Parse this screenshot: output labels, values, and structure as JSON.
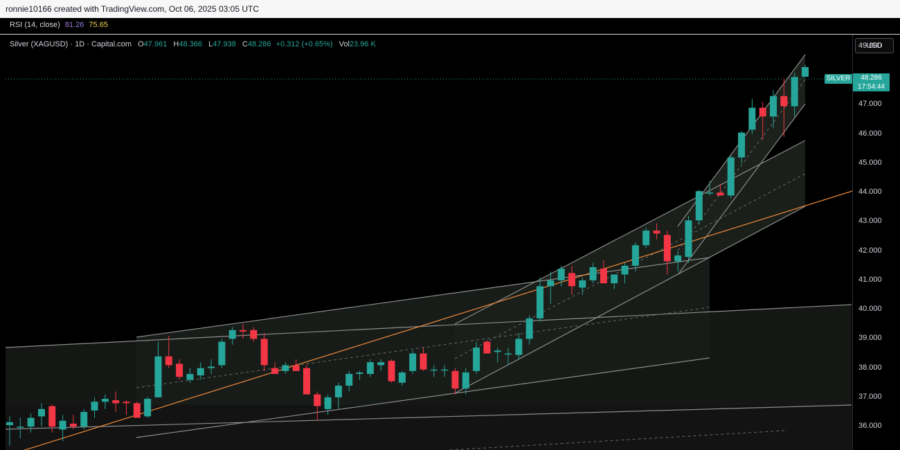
{
  "header": {
    "attribution": "ronnie10166 created with TradingView.com, Oct 06, 2025 03:05 UTC"
  },
  "rsi": {
    "label": "RSI (14, close)",
    "value1": "81.26",
    "value2": "75.65"
  },
  "legend": {
    "symbol": "Silver (XAGUSD) · 1D · Capital.com",
    "o_key": "O",
    "o": "47.961",
    "h_key": "H",
    "h": "48.366",
    "l_key": "L",
    "l": "47.938",
    "c_key": "C",
    "c": "48.286",
    "change": "+0.312 (+0.65%)",
    "vol_key": "Vol",
    "vol": "23.96 K"
  },
  "price_axis": {
    "currency_button": "USD",
    "ticks": [
      "49.000",
      "47.000",
      "46.000",
      "45.000",
      "44.000",
      "43.000",
      "42.000",
      "41.000",
      "40.000",
      "39.000",
      "38.000",
      "37.000",
      "36.000"
    ]
  },
  "last_price": {
    "symbol_tag": "SILVER",
    "price": "48.286",
    "countdown": "17:54:44"
  },
  "colors": {
    "up": "#26a69a",
    "down": "#f23645",
    "channel": "#9a9a9a",
    "trend": "#f08c3c"
  },
  "chart_data": {
    "type": "candlestick",
    "ylim": [
      35.2,
      49.4
    ],
    "candles": [
      {
        "o": 36.05,
        "h": 36.35,
        "l": 35.35,
        "c": 36.15
      },
      {
        "o": 36.0,
        "h": 36.3,
        "l": 35.6,
        "c": 36.0
      },
      {
        "o": 36.0,
        "h": 36.45,
        "l": 35.8,
        "c": 36.3
      },
      {
        "o": 36.35,
        "h": 36.8,
        "l": 36.0,
        "c": 36.6
      },
      {
        "o": 36.7,
        "h": 36.75,
        "l": 35.8,
        "c": 36.0
      },
      {
        "o": 35.9,
        "h": 36.4,
        "l": 35.5,
        "c": 36.2
      },
      {
        "o": 36.1,
        "h": 36.4,
        "l": 35.9,
        "c": 36.0
      },
      {
        "o": 36.0,
        "h": 36.6,
        "l": 35.9,
        "c": 36.5
      },
      {
        "o": 36.55,
        "h": 37.0,
        "l": 36.3,
        "c": 36.85
      },
      {
        "o": 36.85,
        "h": 37.1,
        "l": 36.6,
        "c": 36.95
      },
      {
        "o": 36.9,
        "h": 37.2,
        "l": 36.5,
        "c": 36.8
      },
      {
        "o": 36.85,
        "h": 36.9,
        "l": 36.4,
        "c": 36.8
      },
      {
        "o": 36.8,
        "h": 36.85,
        "l": 36.3,
        "c": 36.3
      },
      {
        "o": 36.35,
        "h": 37.0,
        "l": 36.3,
        "c": 36.95
      },
      {
        "o": 37.0,
        "h": 38.9,
        "l": 37.0,
        "c": 38.4
      },
      {
        "o": 38.4,
        "h": 39.1,
        "l": 38.0,
        "c": 38.1
      },
      {
        "o": 38.15,
        "h": 38.3,
        "l": 37.6,
        "c": 37.7
      },
      {
        "o": 37.6,
        "h": 38.0,
        "l": 37.5,
        "c": 37.8
      },
      {
        "o": 37.75,
        "h": 38.2,
        "l": 37.6,
        "c": 38.0
      },
      {
        "o": 38.0,
        "h": 38.3,
        "l": 37.8,
        "c": 38.05
      },
      {
        "o": 38.1,
        "h": 39.0,
        "l": 38.0,
        "c": 38.9
      },
      {
        "o": 39.0,
        "h": 39.4,
        "l": 38.8,
        "c": 39.3
      },
      {
        "o": 39.3,
        "h": 39.5,
        "l": 39.0,
        "c": 39.25
      },
      {
        "o": 39.3,
        "h": 39.4,
        "l": 38.9,
        "c": 39.0
      },
      {
        "o": 39.0,
        "h": 39.2,
        "l": 37.9,
        "c": 38.1
      },
      {
        "o": 38.0,
        "h": 38.2,
        "l": 37.8,
        "c": 37.8
      },
      {
        "o": 37.9,
        "h": 38.2,
        "l": 37.8,
        "c": 38.1
      },
      {
        "o": 38.1,
        "h": 38.3,
        "l": 37.9,
        "c": 37.9
      },
      {
        "o": 38.0,
        "h": 38.1,
        "l": 37.3,
        "c": 37.1
      },
      {
        "o": 37.1,
        "h": 37.2,
        "l": 36.2,
        "c": 36.7
      },
      {
        "o": 36.6,
        "h": 37.1,
        "l": 36.4,
        "c": 37.0
      },
      {
        "o": 37.0,
        "h": 37.5,
        "l": 36.6,
        "c": 37.4
      },
      {
        "o": 37.4,
        "h": 37.9,
        "l": 37.2,
        "c": 37.8
      },
      {
        "o": 37.8,
        "h": 37.9,
        "l": 37.6,
        "c": 37.85
      },
      {
        "o": 37.8,
        "h": 38.3,
        "l": 37.7,
        "c": 38.2
      },
      {
        "o": 38.1,
        "h": 38.3,
        "l": 37.9,
        "c": 38.2
      },
      {
        "o": 38.25,
        "h": 38.3,
        "l": 37.5,
        "c": 37.55
      },
      {
        "o": 37.5,
        "h": 37.9,
        "l": 37.4,
        "c": 37.85
      },
      {
        "o": 37.9,
        "h": 38.6,
        "l": 37.8,
        "c": 38.5
      },
      {
        "o": 38.5,
        "h": 38.7,
        "l": 37.9,
        "c": 37.95
      },
      {
        "o": 37.95,
        "h": 38.1,
        "l": 37.7,
        "c": 37.95
      },
      {
        "o": 37.95,
        "h": 38.1,
        "l": 37.7,
        "c": 37.95
      },
      {
        "o": 37.9,
        "h": 38.0,
        "l": 37.1,
        "c": 37.3
      },
      {
        "o": 37.3,
        "h": 38.0,
        "l": 37.1,
        "c": 37.85
      },
      {
        "o": 37.9,
        "h": 38.9,
        "l": 37.8,
        "c": 38.7
      },
      {
        "o": 38.9,
        "h": 38.95,
        "l": 38.5,
        "c": 38.5
      },
      {
        "o": 38.55,
        "h": 38.7,
        "l": 38.2,
        "c": 38.6
      },
      {
        "o": 38.5,
        "h": 38.7,
        "l": 38.1,
        "c": 38.5
      },
      {
        "o": 38.45,
        "h": 39.2,
        "l": 38.3,
        "c": 39.0
      },
      {
        "o": 39.0,
        "h": 39.8,
        "l": 38.8,
        "c": 39.7
      },
      {
        "o": 39.7,
        "h": 41.1,
        "l": 39.6,
        "c": 40.8
      },
      {
        "o": 40.8,
        "h": 41.3,
        "l": 40.2,
        "c": 41.0
      },
      {
        "o": 41.0,
        "h": 41.5,
        "l": 40.8,
        "c": 41.4
      },
      {
        "o": 41.25,
        "h": 41.5,
        "l": 40.5,
        "c": 40.8
      },
      {
        "o": 40.75,
        "h": 41.1,
        "l": 40.5,
        "c": 41.0
      },
      {
        "o": 41.0,
        "h": 41.6,
        "l": 40.9,
        "c": 41.45
      },
      {
        "o": 41.4,
        "h": 41.7,
        "l": 40.9,
        "c": 40.9
      },
      {
        "o": 40.9,
        "h": 41.2,
        "l": 40.7,
        "c": 41.2
      },
      {
        "o": 41.2,
        "h": 41.6,
        "l": 40.9,
        "c": 41.5
      },
      {
        "o": 41.5,
        "h": 42.3,
        "l": 41.3,
        "c": 42.2
      },
      {
        "o": 42.2,
        "h": 42.8,
        "l": 42.1,
        "c": 42.7
      },
      {
        "o": 42.7,
        "h": 42.95,
        "l": 42.4,
        "c": 42.6
      },
      {
        "o": 42.55,
        "h": 42.7,
        "l": 41.2,
        "c": 41.65
      },
      {
        "o": 41.65,
        "h": 42.0,
        "l": 41.3,
        "c": 41.85
      },
      {
        "o": 41.8,
        "h": 43.2,
        "l": 41.6,
        "c": 43.05
      },
      {
        "o": 43.05,
        "h": 44.1,
        "l": 42.9,
        "c": 44.05
      },
      {
        "o": 44.0,
        "h": 44.4,
        "l": 43.9,
        "c": 44.0
      },
      {
        "o": 44.0,
        "h": 44.3,
        "l": 43.9,
        "c": 43.9
      },
      {
        "o": 43.9,
        "h": 45.3,
        "l": 43.8,
        "c": 45.2
      },
      {
        "o": 45.2,
        "h": 46.1,
        "l": 45.0,
        "c": 46.05
      },
      {
        "o": 46.15,
        "h": 47.2,
        "l": 46.0,
        "c": 46.9
      },
      {
        "o": 46.9,
        "h": 47.1,
        "l": 45.8,
        "c": 46.6
      },
      {
        "o": 46.6,
        "h": 47.5,
        "l": 46.2,
        "c": 47.3
      },
      {
        "o": 47.3,
        "h": 47.9,
        "l": 45.9,
        "c": 46.95
      },
      {
        "o": 46.95,
        "h": 48.1,
        "l": 46.6,
        "c": 47.95
      },
      {
        "o": 47.96,
        "h": 48.37,
        "l": 47.94,
        "c": 48.29
      }
    ]
  }
}
